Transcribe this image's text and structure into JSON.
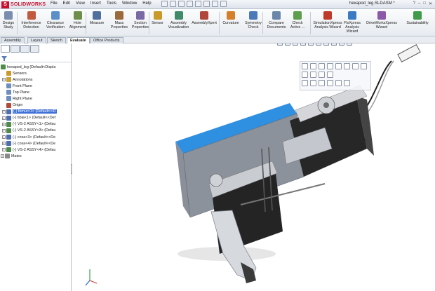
{
  "app": {
    "logo_mark": "S",
    "logo_text": "SOLIDWORKS",
    "document_title": "hexapod_leg.SLDASM *"
  },
  "menu": [
    "File",
    "Edit",
    "View",
    "Insert",
    "Tools",
    "Window",
    "Help"
  ],
  "window_controls": [
    "?",
    "–",
    "□",
    "✕"
  ],
  "ribbon": {
    "buttons": [
      {
        "label": "Design\nStudy",
        "icon": "design-study-icon",
        "color": "#7a8fb0"
      },
      {
        "label": "Interference\nDetection",
        "icon": "interference-icon",
        "color": "#c25b3e"
      },
      {
        "label": "Clearance\nVerification",
        "icon": "clearance-icon",
        "color": "#5a8fc7"
      },
      {
        "label": "Hole\nAlignment",
        "icon": "hole-alignment-icon",
        "color": "#6f8e4a"
      },
      {
        "label": "Measure",
        "icon": "measure-icon",
        "color": "#4f6f9d"
      },
      {
        "label": "Mass\nProperties",
        "icon": "mass-properties-icon",
        "color": "#9b6a3c"
      },
      {
        "label": "Section\nProperties",
        "icon": "section-properties-icon",
        "color": "#7a6aa3"
      },
      {
        "label": "Sensor",
        "icon": "sensor-icon",
        "color": "#c99a2a"
      },
      {
        "label": "Assembly\nVisualization",
        "icon": "assembly-visualization-icon",
        "color": "#3f8a6b"
      },
      {
        "label": "AssemblyXpert",
        "icon": "assembly-xpert-icon",
        "color": "#b1473a"
      },
      {
        "label": "Curvature",
        "icon": "curvature-icon",
        "color": "#d47f2a"
      },
      {
        "label": "Symmetry\nCheck",
        "icon": "symmetry-check-icon",
        "color": "#4c79b8"
      },
      {
        "label": "Compare\nDocuments",
        "icon": "compare-documents-icon",
        "color": "#6b86a8"
      },
      {
        "label": "Check\nActive ...",
        "icon": "check-active-icon",
        "color": "#5e9e4e"
      },
      {
        "label": "SimulationXpress\nAnalysis Wizard",
        "icon": "simulationxpress-icon",
        "color": "#c03a2b"
      },
      {
        "label": "FloXpress\nAnalysis\nWizard",
        "icon": "floxpress-icon",
        "color": "#3a7ac3"
      },
      {
        "label": "DriveWorksXpress\nWizard",
        "icon": "driveworksxpress-icon",
        "color": "#8a5aa8"
      },
      {
        "label": "Sustainability",
        "icon": "sustainability-icon",
        "color": "#3f9a4a"
      }
    ]
  },
  "command_tabs": [
    "Assembly",
    "Layout",
    "Sketch",
    "Evaluate",
    "Office Products"
  ],
  "active_tab": "Evaluate",
  "tree": {
    "root": "hexapod_leg  (Default<Displa",
    "items": [
      {
        "label": "Sensors",
        "icon": "sensors-icon",
        "color": "#c99a2a",
        "expander": "",
        "indent": 1,
        "selected": false
      },
      {
        "label": "Annotations",
        "icon": "annotations-icon",
        "color": "#c9a23a",
        "expander": "+",
        "indent": 1,
        "selected": false
      },
      {
        "label": "Front Plane",
        "icon": "plane-icon",
        "color": "#6d8fc0",
        "expander": "",
        "indent": 1,
        "selected": false
      },
      {
        "label": "Top Plane",
        "icon": "plane-icon",
        "color": "#6d8fc0",
        "expander": "",
        "indent": 1,
        "selected": false
      },
      {
        "label": "Right Plane",
        "icon": "plane-icon",
        "color": "#6d8fc0",
        "expander": "",
        "indent": 1,
        "selected": false
      },
      {
        "label": "Origin",
        "icon": "origin-icon",
        "color": "#b24a3a",
        "expander": "",
        "indent": 1,
        "selected": false
      },
      {
        "label": "(-) femur<1> (Default<<D",
        "icon": "part-icon",
        "color": "#4e6fae",
        "expander": "+",
        "indent": 1,
        "selected": true
      },
      {
        "label": "(-) tibia<1> (Default<<Def",
        "icon": "part-icon",
        "color": "#4e6fae",
        "expander": "+",
        "indent": 1,
        "selected": false
      },
      {
        "label": "(-) VS-2 ASSY<1> (Defau",
        "icon": "subassembly-icon",
        "color": "#4e8a4a",
        "expander": "+",
        "indent": 1,
        "selected": false
      },
      {
        "label": "(-) VS-2 ASSY<3> (Defau",
        "icon": "subassembly-icon",
        "color": "#4e8a4a",
        "expander": "+",
        "indent": 1,
        "selected": false
      },
      {
        "label": "(-) coxa<3> (Default<<De",
        "icon": "part-icon",
        "color": "#4e6fae",
        "expander": "+",
        "indent": 1,
        "selected": false
      },
      {
        "label": "(-) coxa<4> (Default<<De",
        "icon": "part-icon",
        "color": "#4e6fae",
        "expander": "+",
        "indent": 1,
        "selected": false
      },
      {
        "label": "(-) VS-2 ASSY<4> (Defau",
        "icon": "subassembly-icon",
        "color": "#4e8a4a",
        "expander": "+",
        "indent": 1,
        "selected": false
      },
      {
        "label": "Mates",
        "icon": "mates-icon",
        "color": "#8a8a8a",
        "expander": "+",
        "indent": 0,
        "selected": false
      }
    ]
  },
  "colors": {
    "selection": "#3d6fd6",
    "accent_face": "#2f8fe0",
    "part_dark": "#262626",
    "part_light": "#b8bcc4"
  }
}
